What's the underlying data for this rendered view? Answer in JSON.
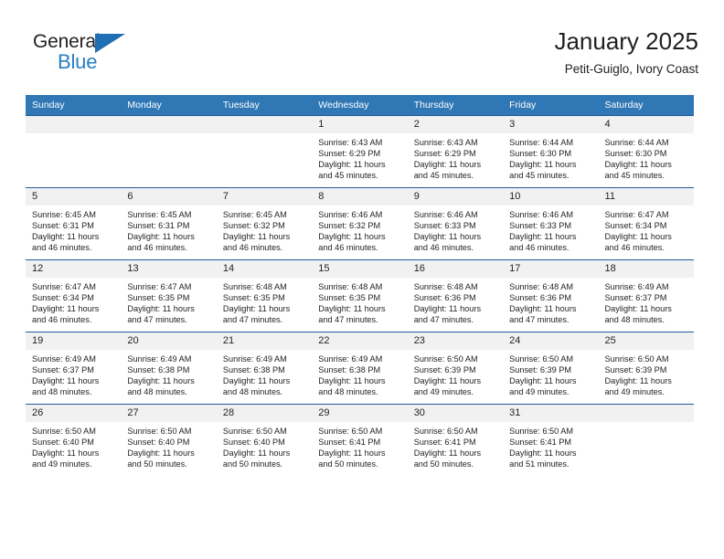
{
  "logo": {
    "word_top": "General",
    "word_bottom": "Blue",
    "triangle_icon": "blue-triangle-icon",
    "brand_color": "#2a7fc1"
  },
  "header": {
    "title": "January 2025",
    "subtitle": "Petit-Guiglo, Ivory Coast"
  },
  "colors": {
    "header_blue": "#3077b5",
    "row_rule": "#1f5c96",
    "daynum_band": "#f1f1f1",
    "text": "#231f20"
  },
  "calendar": {
    "weekday_headers": [
      "Sunday",
      "Monday",
      "Tuesday",
      "Wednesday",
      "Thursday",
      "Friday",
      "Saturday"
    ],
    "labels": {
      "sunrise_prefix": "Sunrise:",
      "sunset_prefix": "Sunset:",
      "daylight_prefix": "Daylight:"
    },
    "weeks": [
      [
        {
          "day": "",
          "sunrise": "",
          "sunset": "",
          "daylight_line1": "",
          "daylight_line2": ""
        },
        {
          "day": "",
          "sunrise": "",
          "sunset": "",
          "daylight_line1": "",
          "daylight_line2": ""
        },
        {
          "day": "",
          "sunrise": "",
          "sunset": "",
          "daylight_line1": "",
          "daylight_line2": ""
        },
        {
          "day": "1",
          "sunrise": "Sunrise: 6:43 AM",
          "sunset": "Sunset: 6:29 PM",
          "daylight_line1": "Daylight: 11 hours",
          "daylight_line2": "and 45 minutes."
        },
        {
          "day": "2",
          "sunrise": "Sunrise: 6:43 AM",
          "sunset": "Sunset: 6:29 PM",
          "daylight_line1": "Daylight: 11 hours",
          "daylight_line2": "and 45 minutes."
        },
        {
          "day": "3",
          "sunrise": "Sunrise: 6:44 AM",
          "sunset": "Sunset: 6:30 PM",
          "daylight_line1": "Daylight: 11 hours",
          "daylight_line2": "and 45 minutes."
        },
        {
          "day": "4",
          "sunrise": "Sunrise: 6:44 AM",
          "sunset": "Sunset: 6:30 PM",
          "daylight_line1": "Daylight: 11 hours",
          "daylight_line2": "and 45 minutes."
        }
      ],
      [
        {
          "day": "5",
          "sunrise": "Sunrise: 6:45 AM",
          "sunset": "Sunset: 6:31 PM",
          "daylight_line1": "Daylight: 11 hours",
          "daylight_line2": "and 46 minutes."
        },
        {
          "day": "6",
          "sunrise": "Sunrise: 6:45 AM",
          "sunset": "Sunset: 6:31 PM",
          "daylight_line1": "Daylight: 11 hours",
          "daylight_line2": "and 46 minutes."
        },
        {
          "day": "7",
          "sunrise": "Sunrise: 6:45 AM",
          "sunset": "Sunset: 6:32 PM",
          "daylight_line1": "Daylight: 11 hours",
          "daylight_line2": "and 46 minutes."
        },
        {
          "day": "8",
          "sunrise": "Sunrise: 6:46 AM",
          "sunset": "Sunset: 6:32 PM",
          "daylight_line1": "Daylight: 11 hours",
          "daylight_line2": "and 46 minutes."
        },
        {
          "day": "9",
          "sunrise": "Sunrise: 6:46 AM",
          "sunset": "Sunset: 6:33 PM",
          "daylight_line1": "Daylight: 11 hours",
          "daylight_line2": "and 46 minutes."
        },
        {
          "day": "10",
          "sunrise": "Sunrise: 6:46 AM",
          "sunset": "Sunset: 6:33 PM",
          "daylight_line1": "Daylight: 11 hours",
          "daylight_line2": "and 46 minutes."
        },
        {
          "day": "11",
          "sunrise": "Sunrise: 6:47 AM",
          "sunset": "Sunset: 6:34 PM",
          "daylight_line1": "Daylight: 11 hours",
          "daylight_line2": "and 46 minutes."
        }
      ],
      [
        {
          "day": "12",
          "sunrise": "Sunrise: 6:47 AM",
          "sunset": "Sunset: 6:34 PM",
          "daylight_line1": "Daylight: 11 hours",
          "daylight_line2": "and 46 minutes."
        },
        {
          "day": "13",
          "sunrise": "Sunrise: 6:47 AM",
          "sunset": "Sunset: 6:35 PM",
          "daylight_line1": "Daylight: 11 hours",
          "daylight_line2": "and 47 minutes."
        },
        {
          "day": "14",
          "sunrise": "Sunrise: 6:48 AM",
          "sunset": "Sunset: 6:35 PM",
          "daylight_line1": "Daylight: 11 hours",
          "daylight_line2": "and 47 minutes."
        },
        {
          "day": "15",
          "sunrise": "Sunrise: 6:48 AM",
          "sunset": "Sunset: 6:35 PM",
          "daylight_line1": "Daylight: 11 hours",
          "daylight_line2": "and 47 minutes."
        },
        {
          "day": "16",
          "sunrise": "Sunrise: 6:48 AM",
          "sunset": "Sunset: 6:36 PM",
          "daylight_line1": "Daylight: 11 hours",
          "daylight_line2": "and 47 minutes."
        },
        {
          "day": "17",
          "sunrise": "Sunrise: 6:48 AM",
          "sunset": "Sunset: 6:36 PM",
          "daylight_line1": "Daylight: 11 hours",
          "daylight_line2": "and 47 minutes."
        },
        {
          "day": "18",
          "sunrise": "Sunrise: 6:49 AM",
          "sunset": "Sunset: 6:37 PM",
          "daylight_line1": "Daylight: 11 hours",
          "daylight_line2": "and 48 minutes."
        }
      ],
      [
        {
          "day": "19",
          "sunrise": "Sunrise: 6:49 AM",
          "sunset": "Sunset: 6:37 PM",
          "daylight_line1": "Daylight: 11 hours",
          "daylight_line2": "and 48 minutes."
        },
        {
          "day": "20",
          "sunrise": "Sunrise: 6:49 AM",
          "sunset": "Sunset: 6:38 PM",
          "daylight_line1": "Daylight: 11 hours",
          "daylight_line2": "and 48 minutes."
        },
        {
          "day": "21",
          "sunrise": "Sunrise: 6:49 AM",
          "sunset": "Sunset: 6:38 PM",
          "daylight_line1": "Daylight: 11 hours",
          "daylight_line2": "and 48 minutes."
        },
        {
          "day": "22",
          "sunrise": "Sunrise: 6:49 AM",
          "sunset": "Sunset: 6:38 PM",
          "daylight_line1": "Daylight: 11 hours",
          "daylight_line2": "and 48 minutes."
        },
        {
          "day": "23",
          "sunrise": "Sunrise: 6:50 AM",
          "sunset": "Sunset: 6:39 PM",
          "daylight_line1": "Daylight: 11 hours",
          "daylight_line2": "and 49 minutes."
        },
        {
          "day": "24",
          "sunrise": "Sunrise: 6:50 AM",
          "sunset": "Sunset: 6:39 PM",
          "daylight_line1": "Daylight: 11 hours",
          "daylight_line2": "and 49 minutes."
        },
        {
          "day": "25",
          "sunrise": "Sunrise: 6:50 AM",
          "sunset": "Sunset: 6:39 PM",
          "daylight_line1": "Daylight: 11 hours",
          "daylight_line2": "and 49 minutes."
        }
      ],
      [
        {
          "day": "26",
          "sunrise": "Sunrise: 6:50 AM",
          "sunset": "Sunset: 6:40 PM",
          "daylight_line1": "Daylight: 11 hours",
          "daylight_line2": "and 49 minutes."
        },
        {
          "day": "27",
          "sunrise": "Sunrise: 6:50 AM",
          "sunset": "Sunset: 6:40 PM",
          "daylight_line1": "Daylight: 11 hours",
          "daylight_line2": "and 50 minutes."
        },
        {
          "day": "28",
          "sunrise": "Sunrise: 6:50 AM",
          "sunset": "Sunset: 6:40 PM",
          "daylight_line1": "Daylight: 11 hours",
          "daylight_line2": "and 50 minutes."
        },
        {
          "day": "29",
          "sunrise": "Sunrise: 6:50 AM",
          "sunset": "Sunset: 6:41 PM",
          "daylight_line1": "Daylight: 11 hours",
          "daylight_line2": "and 50 minutes."
        },
        {
          "day": "30",
          "sunrise": "Sunrise: 6:50 AM",
          "sunset": "Sunset: 6:41 PM",
          "daylight_line1": "Daylight: 11 hours",
          "daylight_line2": "and 50 minutes."
        },
        {
          "day": "31",
          "sunrise": "Sunrise: 6:50 AM",
          "sunset": "Sunset: 6:41 PM",
          "daylight_line1": "Daylight: 11 hours",
          "daylight_line2": "and 51 minutes."
        },
        {
          "day": "",
          "sunrise": "",
          "sunset": "",
          "daylight_line1": "",
          "daylight_line2": ""
        }
      ]
    ]
  }
}
